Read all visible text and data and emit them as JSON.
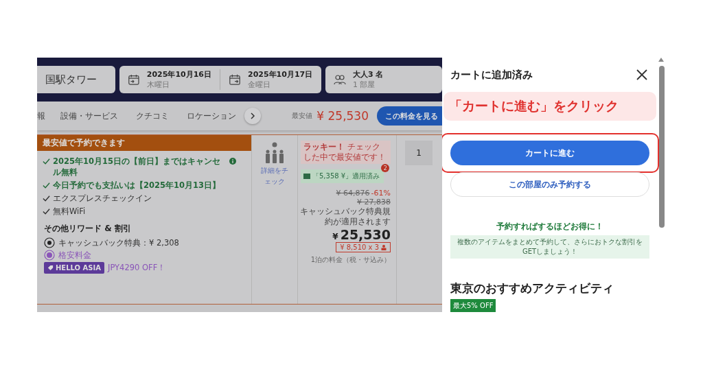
{
  "search_bar": {
    "destination": "国駅タワー",
    "checkin": {
      "date": "2025年10月16日",
      "weekday": "木曜日"
    },
    "checkout": {
      "date": "2025年10月17日",
      "weekday": "金曜日"
    },
    "guests": {
      "people": "大人3 名",
      "rooms": "1 部屋"
    }
  },
  "nav": {
    "tabs": [
      "報",
      "設備・サービス",
      "クチコミ",
      "ロケーション"
    ],
    "price_label": "最安値",
    "price": "¥ 25,530",
    "button": "この料金を見る"
  },
  "offer": {
    "header": "最安値で予約できます",
    "features": [
      {
        "kind": "policy",
        "text": "2025年10月15日の【前日】まではキャンセル無料",
        "info": true
      },
      {
        "kind": "policy",
        "text": "今日予約でも支払いは【2025年10月13日】",
        "info": false
      },
      {
        "kind": "amenity",
        "text": "エクスプレスチェックイン",
        "info": false
      },
      {
        "kind": "amenity",
        "text": "無料WiFi",
        "info": false
      }
    ],
    "rewards_title": "その他リワード & 割引",
    "rewards": [
      {
        "kind": "cashback",
        "text": "キャッシュバック特典：¥ 2,308"
      },
      {
        "kind": "deal",
        "text": "格安料金"
      },
      {
        "kind": "promo",
        "tag": "HELLO ASIA",
        "text": "JPY4290 OFF！"
      }
    ],
    "occupancy_link": "詳細をチェック",
    "lucky_title": "ラッキー！",
    "lucky_text": "チェックした中で最安値です！",
    "applied": "「5,358 ¥」適用済み",
    "applied_badge": "2",
    "original_price": "¥ 64,876",
    "discount": "-61%",
    "second_price": "¥ 27,838",
    "note": "キャッシュバック特典規約が適用されます",
    "currency": "¥",
    "price": "25,530",
    "per_person": "¥ 8,510 x 3",
    "price_note": "1泊の料金（税・サ込み）",
    "quantity": "1"
  },
  "cart": {
    "title": "カートに追加済み",
    "callout": "「カートに進む」をクリック",
    "buttons": [
      {
        "kind": "primary",
        "label": "カートに進む",
        "highlighted": true
      },
      {
        "kind": "secondary",
        "label": "この部屋のみ予約する",
        "highlighted": false
      }
    ],
    "promo_title": "予約すればするほどお得に！",
    "promo_text": "複数のアイテムをまとめて予約して、さらにおトクな割引をGETしましょう！",
    "section_title": "東京のおすすめアクティビティ",
    "section_badge": "最大5% OFF"
  }
}
